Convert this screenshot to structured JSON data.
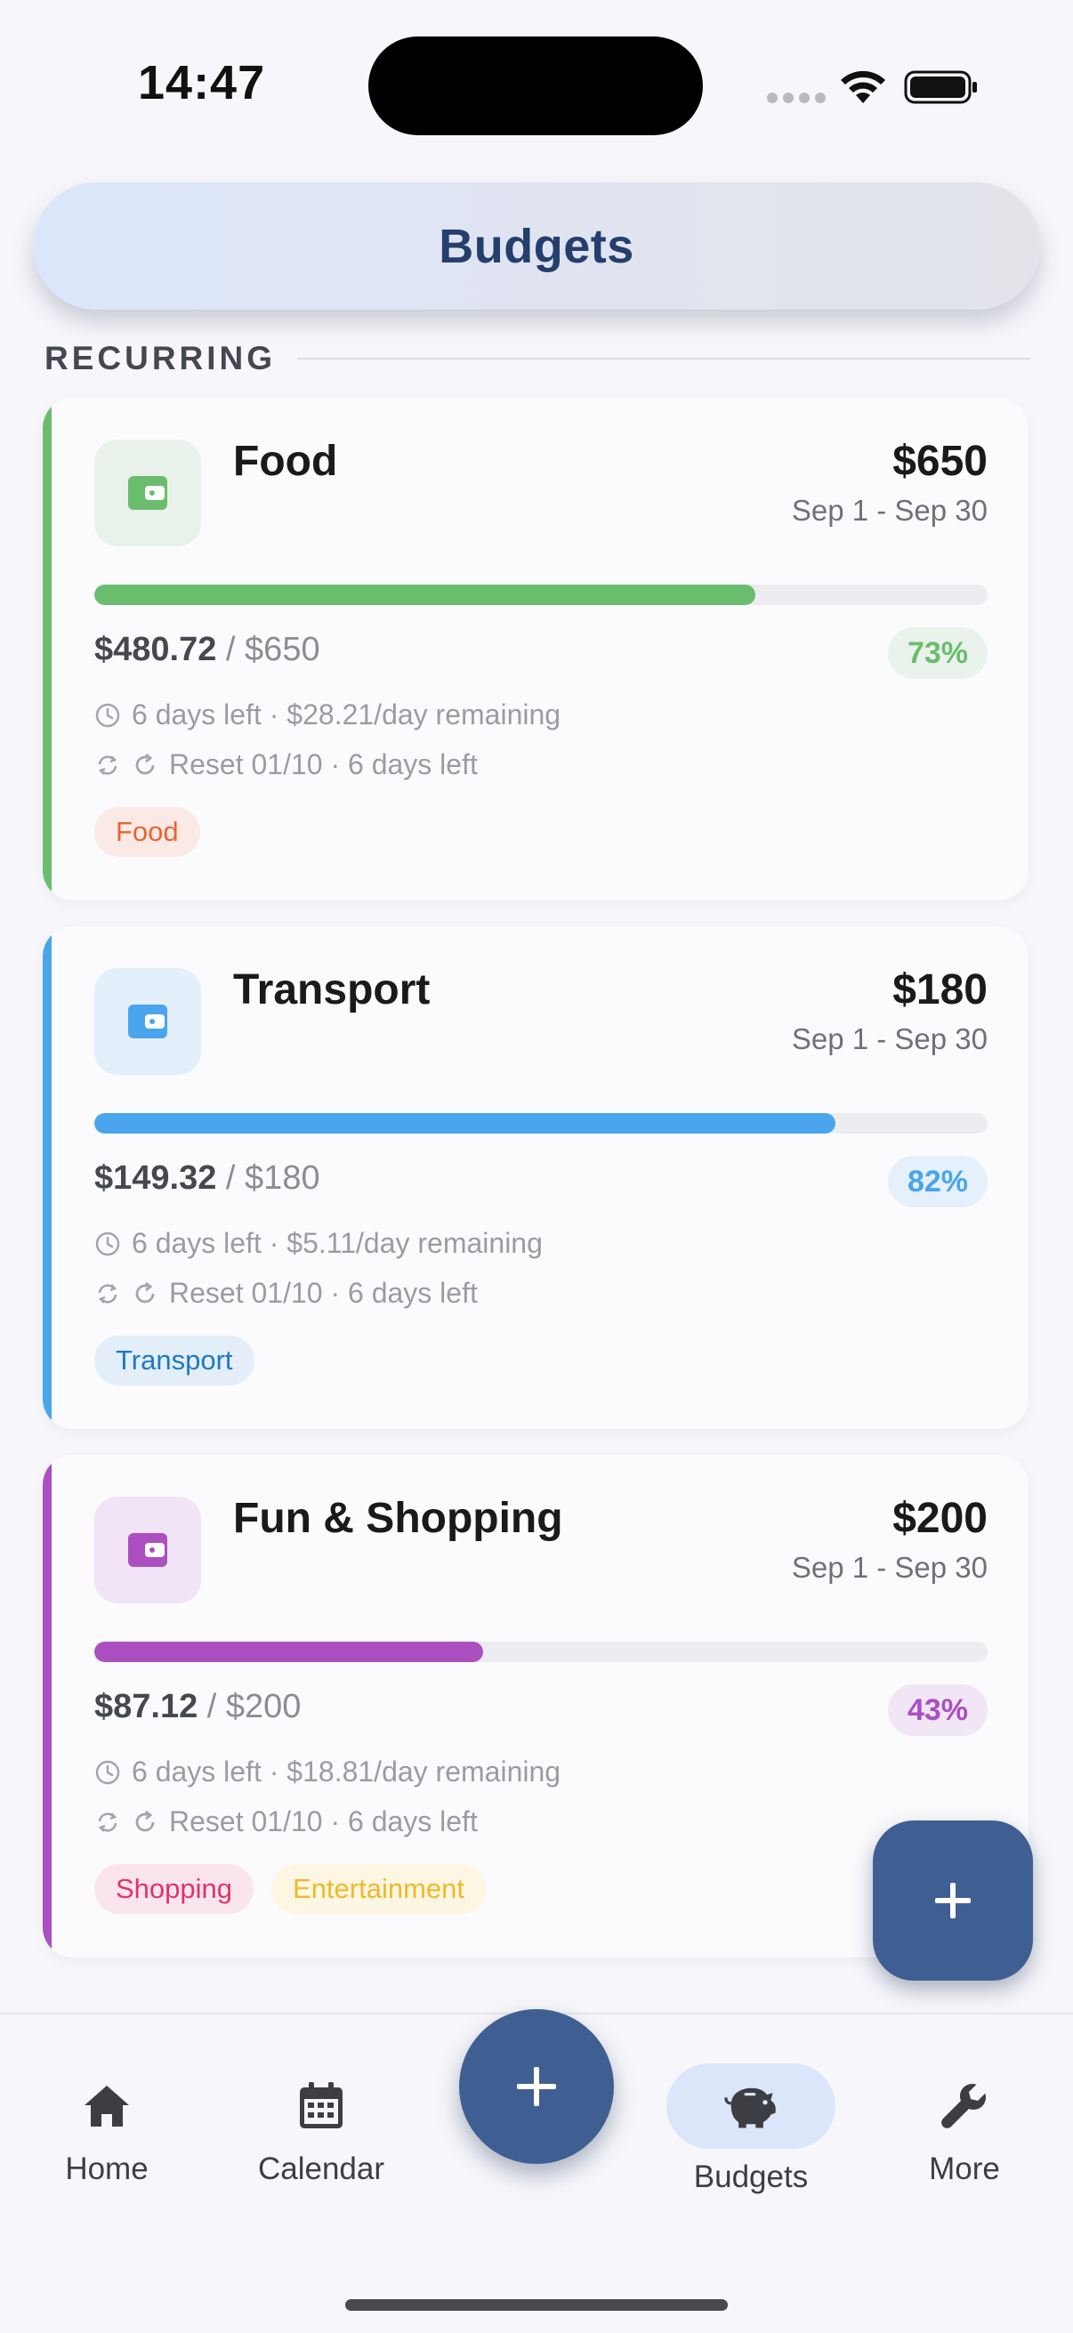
{
  "status_bar": {
    "time": "14:47"
  },
  "header": {
    "title": "Budgets"
  },
  "section": {
    "title": "RECURRING"
  },
  "budgets": [
    {
      "name": "Food",
      "amount": "$650",
      "period": "Sep 1 - Sep 30",
      "spent": "$480.72",
      "limit": " / $650",
      "percent_label": "73%",
      "progress": 0.74,
      "days_info": "6 days left · $28.21/day remaining",
      "reset_info": "Reset 01/10 · 6 days left",
      "accent_color": "#6bbd6e",
      "tags": [
        {
          "label": "Food",
          "color": "#e8662f",
          "bg": "#fbe9e6"
        }
      ]
    },
    {
      "name": "Transport",
      "amount": "$180",
      "period": "Sep 1 - Sep 30",
      "spent": "$149.32",
      "limit": " / $180",
      "percent_label": "82%",
      "progress": 0.83,
      "days_info": "6 days left · $5.11/day remaining",
      "reset_info": "Reset 01/10 · 6 days left",
      "accent_color": "#4aa5ec",
      "tags": [
        {
          "label": "Transport",
          "color": "#1f78c4",
          "bg": "#e3eef9"
        }
      ]
    },
    {
      "name": "Fun & Shopping",
      "amount": "$200",
      "period": "Sep 1 - Sep 30",
      "spent": "$87.12",
      "limit": " / $200",
      "percent_label": "43%",
      "progress": 0.435,
      "days_info": "6 days left · $18.81/day remaining",
      "reset_info": "Reset 01/10 · 6 days left",
      "accent_color": "#ab4fc0",
      "tags": [
        {
          "label": "Shopping",
          "color": "#e0336d",
          "bg": "#fbe5ec"
        },
        {
          "label": "Entertainment",
          "color": "#f0b92a",
          "bg": "#fdf6e2"
        }
      ]
    }
  ],
  "bottom_nav": {
    "items": [
      {
        "label": "Home",
        "icon": "home-icon"
      },
      {
        "label": "Calendar",
        "icon": "calendar-icon"
      },
      {
        "label": "Budgets",
        "icon": "piggy-bank-icon",
        "active": true
      },
      {
        "label": "More",
        "icon": "wrench-icon"
      }
    ]
  },
  "colors": {
    "primary": "#3f5f92",
    "header_text": "#243f6d",
    "active_nav_bg": "#dce6fa"
  }
}
